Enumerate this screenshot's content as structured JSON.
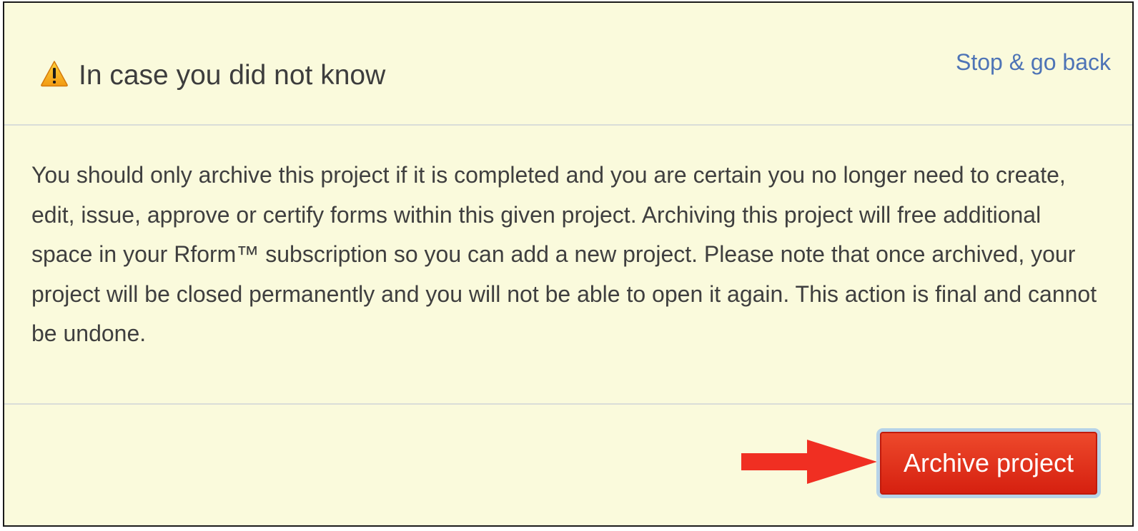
{
  "dialog": {
    "title": "In case you did not know",
    "title_icon": "warning-triangle-icon",
    "back_link": "Stop & go back",
    "message": "You should only archive this project if it is completed and you are certain you no longer need to create, edit, issue, approve or certify forms within this given project. Archiving this project will free additional space in your Rform™ subscription so you can add a new project. Please note that once archived, your project will be closed permanently and you will not be able to open it again. This action is final and cannot be undone.",
    "archive_button": "Archive project",
    "annotation": "red-arrow-pointer"
  },
  "colors": {
    "background": "#fafadc",
    "link": "#4e74b6",
    "button": "#d51f0f",
    "button_border": "#b6d3e8",
    "arrow": "#f02f22",
    "text": "#3f3f3f"
  }
}
